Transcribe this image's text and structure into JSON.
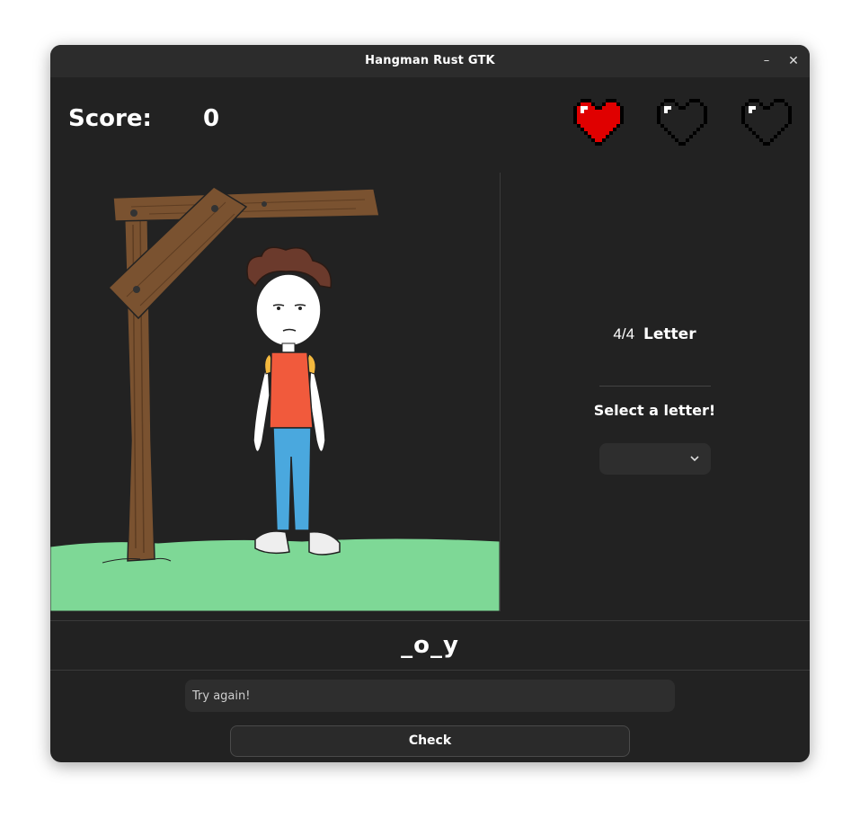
{
  "window": {
    "title": "Hangman Rust GTK",
    "minimize_glyph": "–",
    "close_glyph": "✕"
  },
  "score": {
    "label": "Score:",
    "value": "0"
  },
  "lives": {
    "total": 3,
    "remaining": 1,
    "full_color": "#e00000",
    "empty_color": "#000000"
  },
  "letter_info": {
    "count": "4/4",
    "label": "Letter"
  },
  "prompt": "Select a letter!",
  "letter_select": {
    "selected": ""
  },
  "word": "_o_y",
  "message_field": {
    "value": "Try again!"
  },
  "check_button": {
    "label": "Check"
  },
  "icons": [
    "heart-full-icon",
    "heart-empty-icon",
    "chevron-down-icon"
  ]
}
